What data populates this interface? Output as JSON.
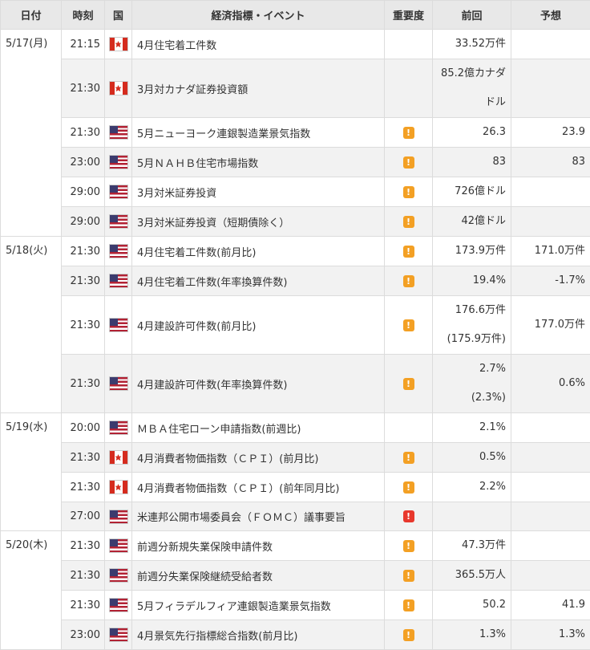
{
  "headers": {
    "date": "日付",
    "time": "時刻",
    "country": "国",
    "event": "経済指標・イベント",
    "importance": "重要度",
    "previous": "前回",
    "forecast": "予想"
  },
  "colors": {
    "importance_medium": "#f3a024",
    "importance_high": "#e8382d",
    "row_alt": "#f2f2f2",
    "header_bg": "#e8e8e8"
  },
  "groups": [
    {
      "date": "5/17(月)",
      "rows": [
        {
          "time": "21:15",
          "country": "CA",
          "flag_icon": "canada-flag-icon",
          "event": "4月住宅着工件数",
          "importance": "",
          "previous": "33.52万件",
          "forecast": ""
        },
        {
          "time": "21:30",
          "country": "CA",
          "flag_icon": "canada-flag-icon",
          "event": "3月対カナダ証券投資額",
          "importance": "",
          "previous": "85.2億カナダ",
          "previous_line2": "ドル",
          "forecast": ""
        },
        {
          "time": "21:30",
          "country": "US",
          "flag_icon": "us-flag-icon",
          "event": "5月ニューヨーク連銀製造業景気指数",
          "importance": "medium",
          "previous": "26.3",
          "forecast": "23.9"
        },
        {
          "time": "23:00",
          "country": "US",
          "flag_icon": "us-flag-icon",
          "event": "5月ＮＡＨＢ住宅市場指数",
          "importance": "medium",
          "previous": "83",
          "forecast": "83"
        },
        {
          "time": "29:00",
          "country": "US",
          "flag_icon": "us-flag-icon",
          "event": "3月対米証券投資",
          "importance": "medium",
          "previous": "726億ドル",
          "forecast": ""
        },
        {
          "time": "29:00",
          "country": "US",
          "flag_icon": "us-flag-icon",
          "event": "3月対米証券投資（短期債除く）",
          "importance": "medium",
          "previous": "42億ドル",
          "forecast": ""
        }
      ]
    },
    {
      "date": "5/18(火)",
      "rows": [
        {
          "time": "21:30",
          "country": "US",
          "flag_icon": "us-flag-icon",
          "event": "4月住宅着工件数(前月比)",
          "importance": "medium",
          "previous": "173.9万件",
          "forecast": "171.0万件"
        },
        {
          "time": "21:30",
          "country": "US",
          "flag_icon": "us-flag-icon",
          "event": "4月住宅着工件数(年率換算件数)",
          "importance": "medium",
          "previous": "19.4%",
          "forecast": "-1.7%"
        },
        {
          "time": "21:30",
          "country": "US",
          "flag_icon": "us-flag-icon",
          "event": "4月建設許可件数(前月比)",
          "importance": "medium",
          "previous": "176.6万件",
          "previous_line2": "(175.9万件)",
          "forecast": "177.0万件"
        },
        {
          "time": "21:30",
          "country": "US",
          "flag_icon": "us-flag-icon",
          "event": "4月建設許可件数(年率換算件数)",
          "importance": "medium",
          "previous": "2.7%",
          "previous_line2": "(2.3%)",
          "forecast": "0.6%"
        }
      ]
    },
    {
      "date": "5/19(水)",
      "rows": [
        {
          "time": "20:00",
          "country": "US",
          "flag_icon": "us-flag-icon",
          "event": "ＭＢＡ住宅ローン申請指数(前週比)",
          "importance": "",
          "previous": "2.1%",
          "forecast": ""
        },
        {
          "time": "21:30",
          "country": "CA",
          "flag_icon": "canada-flag-icon",
          "event": "4月消費者物価指数（ＣＰＩ）(前月比)",
          "importance": "medium",
          "previous": "0.5%",
          "forecast": ""
        },
        {
          "time": "21:30",
          "country": "CA",
          "flag_icon": "canada-flag-icon",
          "event": "4月消費者物価指数（ＣＰＩ）(前年同月比)",
          "importance": "medium",
          "previous": "2.2%",
          "forecast": ""
        },
        {
          "time": "27:00",
          "country": "US",
          "flag_icon": "us-flag-icon",
          "event": "米連邦公開市場委員会（ＦＯＭＣ）議事要旨",
          "importance": "high",
          "previous": "",
          "forecast": ""
        }
      ]
    },
    {
      "date": "5/20(木)",
      "rows": [
        {
          "time": "21:30",
          "country": "US",
          "flag_icon": "us-flag-icon",
          "event": "前週分新規失業保険申請件数",
          "importance": "medium",
          "previous": "47.3万件",
          "forecast": ""
        },
        {
          "time": "21:30",
          "country": "US",
          "flag_icon": "us-flag-icon",
          "event": "前週分失業保険継続受給者数",
          "importance": "medium",
          "previous": "365.5万人",
          "forecast": ""
        },
        {
          "time": "21:30",
          "country": "US",
          "flag_icon": "us-flag-icon",
          "event": "5月フィラデルフィア連銀製造業景気指数",
          "importance": "medium",
          "previous": "50.2",
          "forecast": "41.9"
        },
        {
          "time": "23:00",
          "country": "US",
          "flag_icon": "us-flag-icon",
          "event": "4月景気先行指標総合指数(前月比)",
          "importance": "medium",
          "previous": "1.3%",
          "forecast": "1.3%"
        }
      ]
    }
  ],
  "importance_glyph": "!"
}
